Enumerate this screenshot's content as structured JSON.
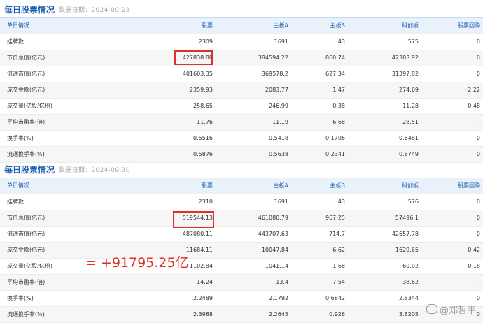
{
  "panel1": {
    "title": "每日股票情况",
    "date_label": "数据日期：",
    "date_value": "2024-09-23",
    "headers": [
      "单日情况",
      "股票",
      "主板A",
      "主板B",
      "科创板",
      "股票回购"
    ],
    "rows": [
      [
        "挂牌数",
        "2309",
        "1691",
        "43",
        "575",
        "0"
      ],
      [
        "市价总值(亿元)",
        "427838.88",
        "384594.22",
        "860.74",
        "42383.92",
        "0"
      ],
      [
        "流通市值(亿元)",
        "401603.35",
        "369578.2",
        "627.34",
        "31397.82",
        "0"
      ],
      [
        "成交金额(亿元)",
        "2359.93",
        "2083.77",
        "1.47",
        "274.69",
        "2.22"
      ],
      [
        "成交量(亿股/亿份)",
        "258.65",
        "246.99",
        "0.38",
        "11.28",
        "0.48"
      ],
      [
        "平均市盈率(倍)",
        "11.76",
        "11.19",
        "6.68",
        "28.51",
        "-"
      ],
      [
        "换手率(%)",
        "0.5516",
        "0.5418",
        "0.1706",
        "0.6481",
        "0"
      ],
      [
        "流通换手率(%)",
        "0.5876",
        "0.5638",
        "0.2341",
        "0.8749",
        "0"
      ]
    ]
  },
  "panel2": {
    "title": "每日股票情况",
    "date_label": "数据日期：",
    "date_value": "2024-09-30",
    "headers": [
      "单日情况",
      "股票",
      "主板A",
      "主板B",
      "科创板",
      "股票回购"
    ],
    "rows": [
      [
        "挂牌数",
        "2310",
        "1691",
        "43",
        "576",
        "0"
      ],
      [
        "市价总值(亿元)",
        "519544.13",
        "461080.79",
        "967.25",
        "57496.1",
        "0"
      ],
      [
        "流通市值(亿元)",
        "487080.11",
        "443707.63",
        "714.7",
        "42657.78",
        "0"
      ],
      [
        "成交金额(亿元)",
        "11684.11",
        "10047.84",
        "6.62",
        "1629.65",
        "0.42"
      ],
      [
        "成交量(亿股/亿份)",
        "1102.84",
        "1041.14",
        "1.68",
        "60.02",
        "0.18"
      ],
      [
        "平均市盈率(倍)",
        "14.24",
        "13.4",
        "7.54",
        "38.62",
        "-"
      ],
      [
        "换手率(%)",
        "2.2489",
        "2.1792",
        "0.6842",
        "2.8344",
        "0"
      ],
      [
        "流通换手率(%)",
        "2.3988",
        "2.2645",
        "0.926",
        "3.8205",
        "0"
      ]
    ]
  },
  "annotation": {
    "difference": "= +91795.25亿"
  },
  "watermark": {
    "text": "@郑哲平"
  },
  "colors": {
    "title": "#1f5fb0",
    "header_bg": "#e9f1fa",
    "highlight": "#e0302b"
  }
}
